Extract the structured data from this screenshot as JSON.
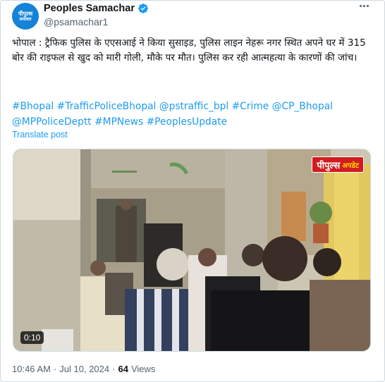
{
  "author": {
    "display_name": "Peoples Samachar",
    "handle": "@psamachar1",
    "avatar_line1": "पीपुल्स",
    "avatar_line2": "समाचार",
    "avatar_color": "#1583d8",
    "verified": true,
    "verified_icon": "verified-badge-icon"
  },
  "post": {
    "text": "भोपाल : ट्रैफिक पुलिस के एएसआई ने किया सुसाइड, पुलिस लाइन नेहरू नगर स्थित अपने घर में 315 बोर की राइफल से खुद को मारी गोली, मौके पर मौत। पुलिस कर रही आत्महत्या के कारणों की जांच।",
    "tags": [
      "#Bhopal",
      "#TrafficPoliceBhopal",
      "@pstraffic_bpl",
      "#Crime",
      "@CP_Bhopal",
      "@MPPoliceDeptt",
      "#MPNews",
      "#PeoplesUpdate"
    ],
    "translate_label": "Translate post"
  },
  "media": {
    "badge_main": "पीपुल्स",
    "badge_sub": "अपडेट",
    "duration": "0:10"
  },
  "meta": {
    "time": "10:46 AM",
    "separator": "·",
    "date": "Jul 10, 2024",
    "views_count": "64",
    "views_label": "Views"
  },
  "colors": {
    "link": "#1d9bf0",
    "text": "#0f1419",
    "secondary": "#536471",
    "badge": "#d01c1f"
  }
}
